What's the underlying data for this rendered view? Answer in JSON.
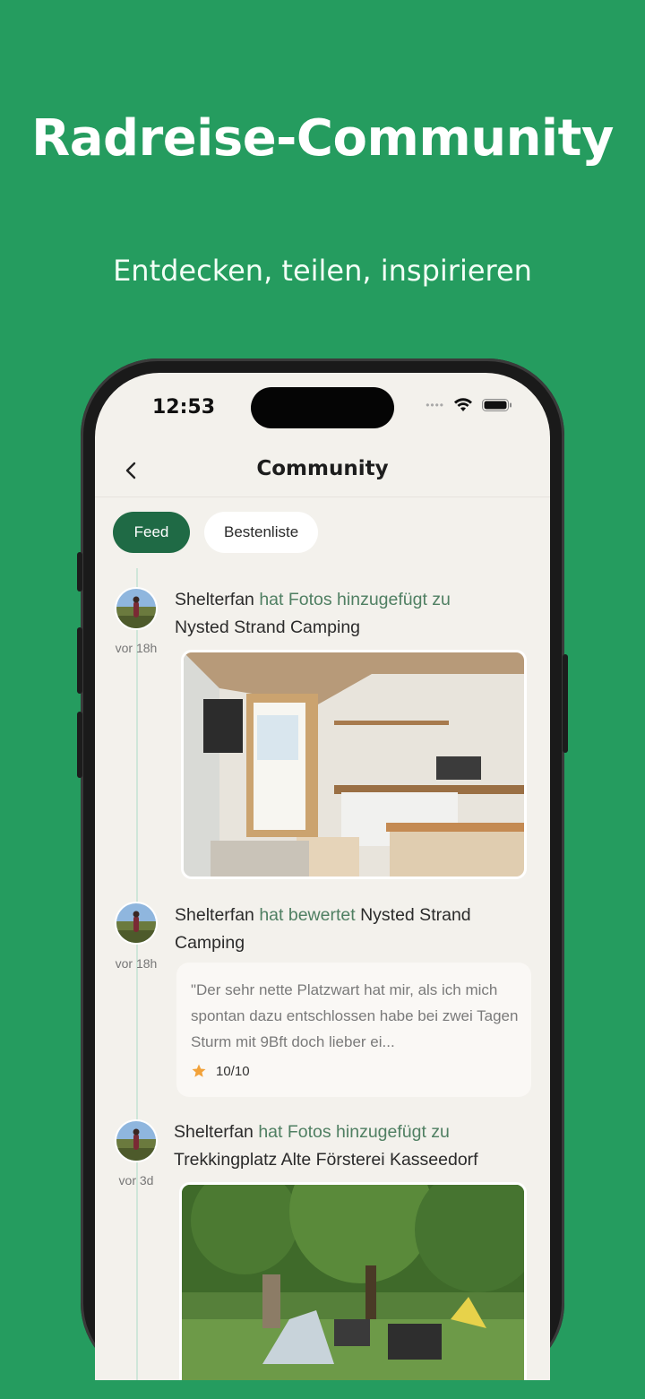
{
  "promo": {
    "headline": "Radreise-Community",
    "subline": "Entdecken, teilen, inspirieren"
  },
  "status_bar": {
    "time": "12:53",
    "icons": [
      "signal-dots-icon",
      "wifi-icon",
      "battery-icon"
    ]
  },
  "nav": {
    "back_icon": "chevron-left-icon",
    "title": "Community"
  },
  "tabs": [
    {
      "label": "Feed",
      "active": true
    },
    {
      "label": "Bestenliste",
      "active": false
    }
  ],
  "feed": [
    {
      "user": "Shelterfan",
      "action": "hat Fotos hinzugefügt zu",
      "place": "Nysted Strand Camping",
      "ago": "vor 18h",
      "type": "photo"
    },
    {
      "user": "Shelterfan",
      "action": "hat bewertet",
      "place": "Nysted Strand Camping",
      "ago": "vor 18h",
      "type": "review",
      "review_text": "\"Der sehr nette Platzwart hat mir, als ich mich spontan dazu entschlossen habe bei zwei Tagen Sturm mit 9Bft doch lieber ei...",
      "rating": "10/10"
    },
    {
      "user": "Shelterfan",
      "action": "hat Fotos hinzugefügt zu",
      "place": "Trekkingplatz Alte Försterei Kasseedorf",
      "ago": "vor 3d",
      "type": "photo"
    }
  ],
  "colors": {
    "background": "#259c5f",
    "accent": "#1f6a45",
    "muted_action": "#4f7f62",
    "star": "#f2a23a"
  }
}
